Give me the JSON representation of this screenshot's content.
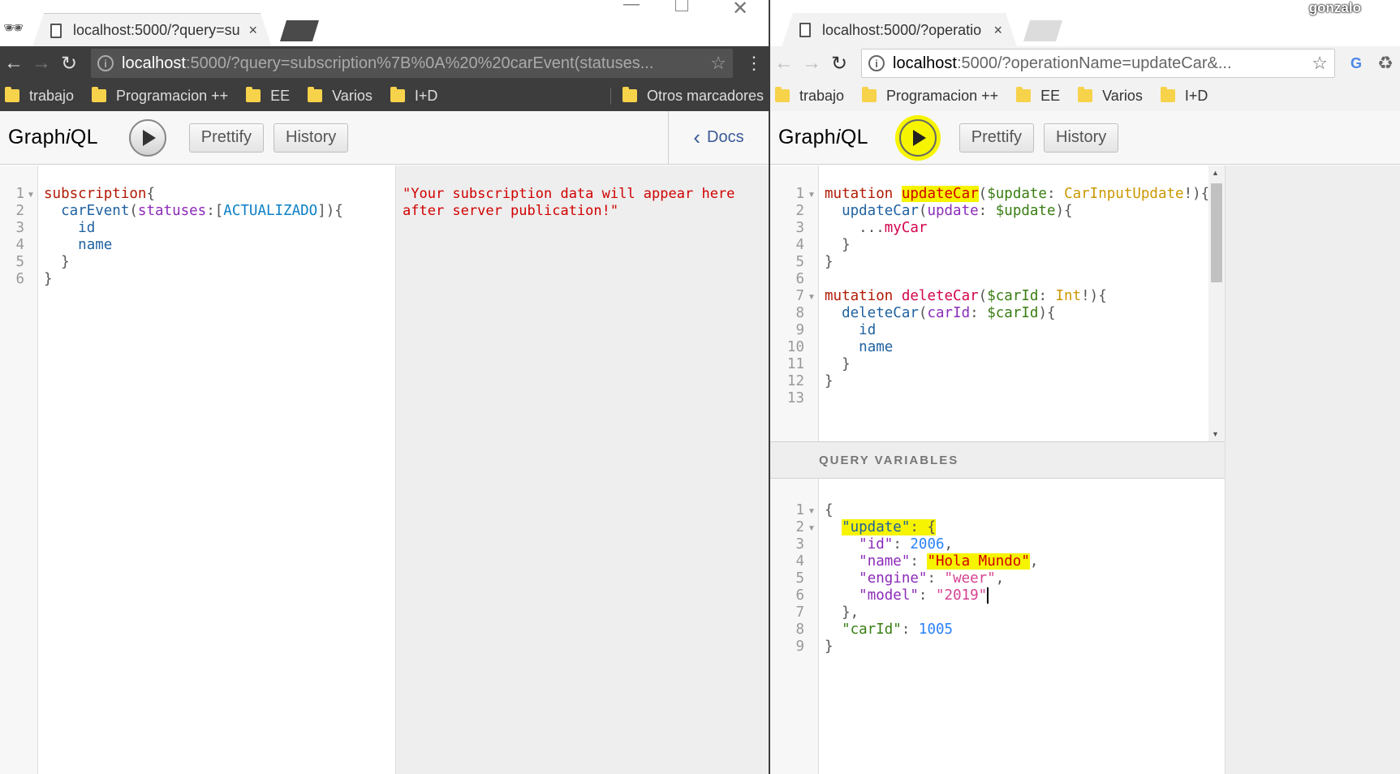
{
  "left": {
    "tab_title": "localhost:5000/?query=su",
    "tab_close": "×",
    "url_host": "localhost",
    "url_rest": ":5000/?query=subscription%7B%0A%20%20carEvent(statuses...",
    "bookmarks": [
      "trabajo",
      "Programacion ++",
      "EE",
      "Varios",
      "I+D"
    ],
    "other_bookmarks": "Otros marcadores",
    "graphiql": {
      "logo_pre": "Graph",
      "logo_i": "i",
      "logo_post": "QL",
      "prettify": "Prettify",
      "history": "History",
      "docs": "Docs"
    },
    "editor_lines": [
      "1",
      "2",
      "3",
      "4",
      "5",
      "6"
    ],
    "result_text_1": "\"Your subscription data will appear here",
    "result_text_2": "after server publication!\""
  },
  "right": {
    "tab_title": "localhost:5000/?operatio",
    "tab_close": "×",
    "url_host": "localhost",
    "url_rest": ":5000/?operationName=updateCar&...",
    "user_name": "gonzalo",
    "bookmarks": [
      "trabajo",
      "Programacion ++",
      "EE",
      "Varios",
      "I+D"
    ],
    "graphiql": {
      "logo_pre": "Graph",
      "logo_i": "i",
      "logo_post": "QL",
      "prettify": "Prettify",
      "history": "History"
    },
    "editor_lines": [
      "1",
      "2",
      "3",
      "4",
      "5",
      "6",
      "7",
      "8",
      "9",
      "10",
      "11",
      "12",
      "13"
    ],
    "query_variables_title": "QUERY VARIABLES",
    "variables_lines": [
      "1",
      "2",
      "3",
      "4",
      "5",
      "6",
      "7",
      "8",
      "9"
    ]
  },
  "icons": {
    "back": "←",
    "forward": "→",
    "reload": "↻",
    "star": "☆",
    "menu": "⋮",
    "info": "i",
    "play": "▶"
  }
}
